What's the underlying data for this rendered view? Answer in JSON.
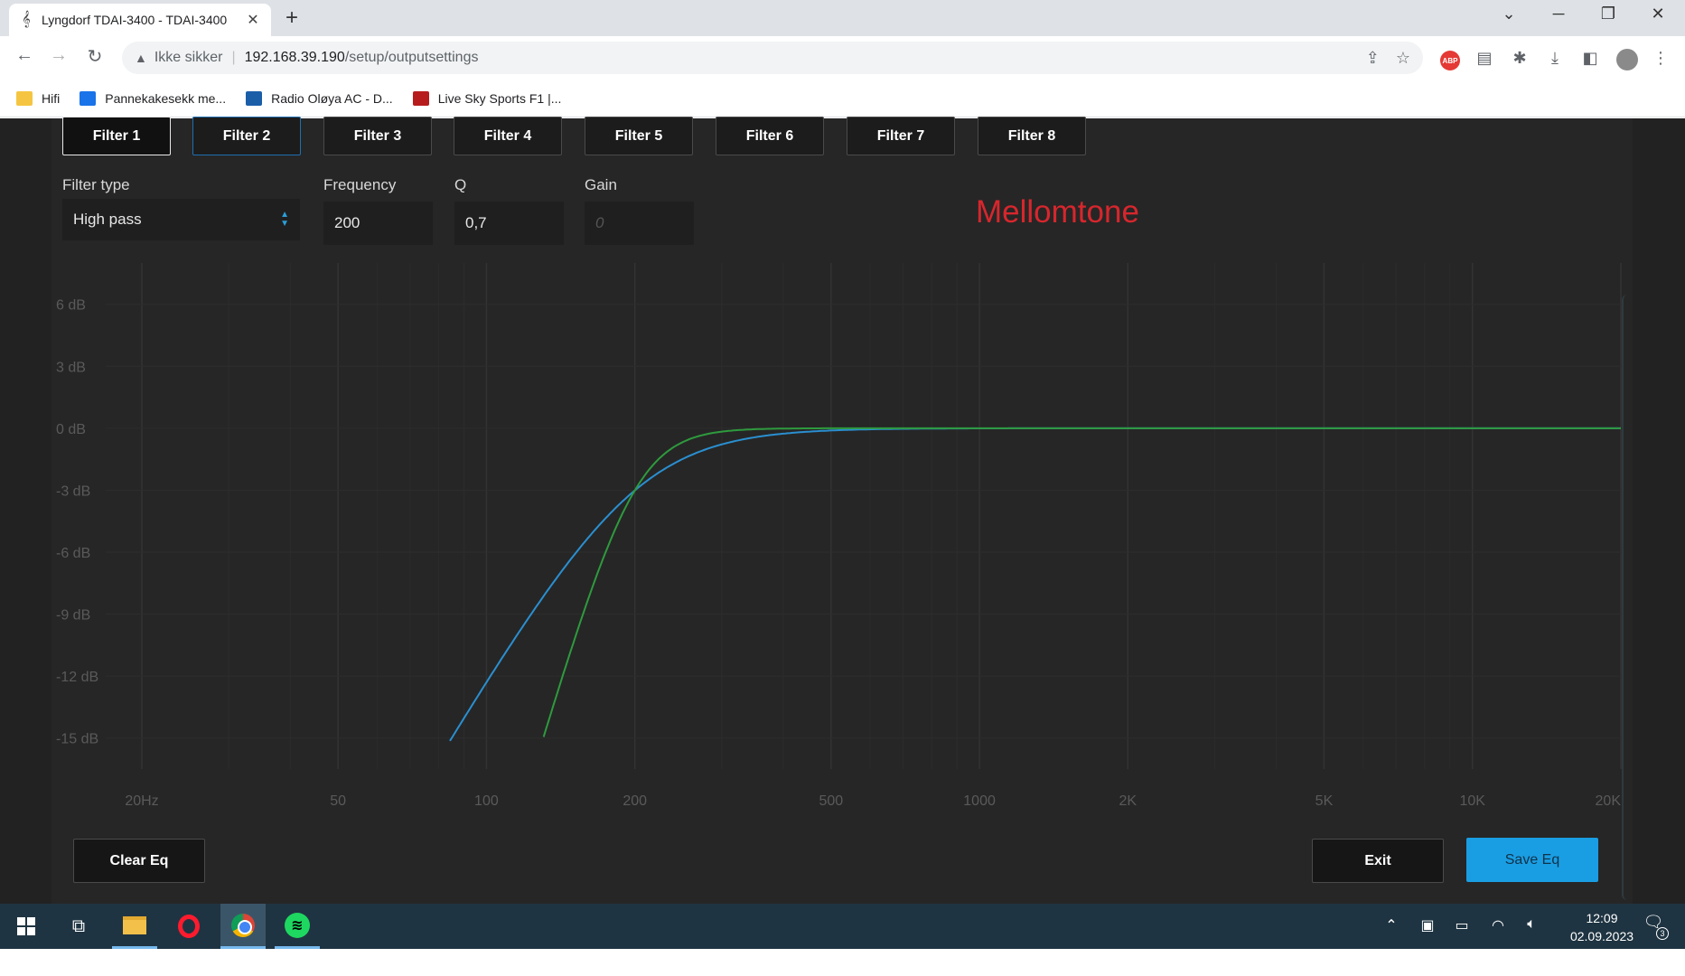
{
  "browser": {
    "tab_title": "Lyngdorf TDAI-3400 - TDAI-3400",
    "tab_icon": "treble-clef-icon",
    "address": {
      "security_label": "Ikke sikker",
      "host": "192.168.39.190",
      "path": "/setup/outputsettings"
    },
    "bookmarks": [
      {
        "label": "Hifi",
        "icon": "folder-icon"
      },
      {
        "label": "Pannekakesekk me...",
        "icon": "nrk-icon"
      },
      {
        "label": "Radio Oløya AC - D...",
        "icon": "radio-icon"
      },
      {
        "label": "Live Sky Sports F1 |...",
        "icon": "sky-sports-icon"
      }
    ]
  },
  "eq": {
    "filter_tabs": [
      "Filter 1",
      "Filter 2",
      "Filter 3",
      "Filter 4",
      "Filter 5",
      "Filter 6",
      "Filter 7",
      "Filter 8"
    ],
    "active_tab_index": 0,
    "selected_tab_index": 1,
    "filter_type": {
      "label": "Filter type",
      "value": "High pass"
    },
    "frequency": {
      "label": "Frequency",
      "value": "200"
    },
    "q": {
      "label": "Q",
      "value": "0,7"
    },
    "gain": {
      "label": "Gain",
      "placeholder": "0"
    },
    "annotation": "Mellomtone",
    "clear_label": "Clear Eq",
    "exit_label": "Exit",
    "save_label": "Save Eq"
  },
  "chart_data": {
    "type": "line",
    "x_scale": "log",
    "xlim": [
      20,
      20000
    ],
    "ylim": [
      -16.5,
      8
    ],
    "x_ticks": [
      20,
      50,
      100,
      200,
      500,
      1000,
      2000,
      5000,
      10000,
      20000
    ],
    "x_tick_labels": [
      "20Hz",
      "50",
      "100",
      "200",
      "500",
      "1000",
      "2K",
      "5K",
      "10K",
      "20K"
    ],
    "y_ticks": [
      6,
      3,
      0,
      -3,
      -6,
      -9,
      -12,
      -15
    ],
    "y_tick_labels": [
      "6 dB",
      "3 dB",
      "0 dB",
      "-3 dB",
      "-6 dB",
      "-9 dB",
      "-12 dB",
      "-15 dB"
    ],
    "grid": true,
    "series": [
      {
        "color": "#2a8fd0",
        "filter": "high pass",
        "cutoff_hz": 200,
        "order": 2
      },
      {
        "color": "#2e9a3e",
        "filter": "high pass",
        "cutoff_hz": 200,
        "order": 4
      }
    ]
  },
  "colors": {
    "background": "#222222",
    "panel": "#262626",
    "accent": "#1a9ee3",
    "annotation": "#d7262d"
  },
  "taskbar": {
    "apps": [
      "windows-start-icon",
      "task-view-icon",
      "file-explorer-icon",
      "opera-icon",
      "chrome-icon",
      "spotify-icon"
    ],
    "time": "12:09",
    "date": "02.09.2023",
    "notification_count": "3"
  }
}
